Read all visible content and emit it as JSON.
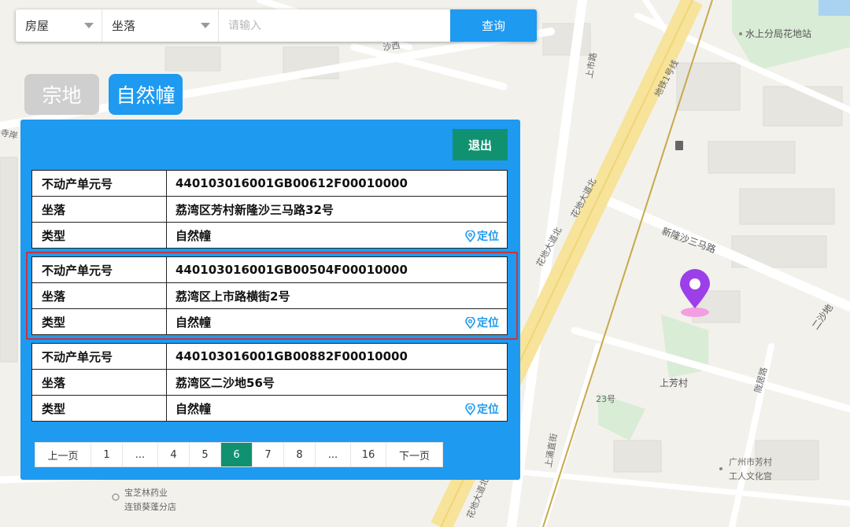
{
  "search": {
    "category_selected": "房屋",
    "field_selected": "坐落",
    "placeholder": "请输入",
    "query_label": "查询"
  },
  "modes": {
    "zongdi": "宗地",
    "ziran": "自然幢"
  },
  "panel": {
    "exit_label": "退出",
    "locate_label": "定位",
    "records": [
      {
        "label_id": "不动产单元号",
        "id": "440103016001GB00612F00010000",
        "label_loc": "坐落",
        "location": "荔湾区芳村新隆沙三马路32号",
        "label_type": "类型",
        "type": "自然幢"
      },
      {
        "label_id": "不动产单元号",
        "id": "440103016001GB00504F00010000",
        "label_loc": "坐落",
        "location": "荔湾区上市路横街2号",
        "label_type": "类型",
        "type": "自然幢"
      },
      {
        "label_id": "不动产单元号",
        "id": "440103016001GB00882F00010000",
        "label_loc": "坐落",
        "location": "荔湾区二沙地56号",
        "label_type": "类型",
        "type": "自然幢"
      }
    ],
    "pagination": {
      "prev": "上一页",
      "pages": [
        "1",
        "...",
        "4",
        "5",
        "6",
        "7",
        "8",
        "...",
        "16"
      ],
      "current": "6",
      "next": "下一页"
    }
  },
  "map": {
    "labels": {
      "water_station": "水上分局花地站",
      "metro": "地铁1号线",
      "shangshi_road": "上市路",
      "huadi_a": "花地大道北",
      "huadi_b": "花地大道北",
      "huadi_c": "花地大道北",
      "xinlongsha": "新隆沙三马路",
      "ershadi": "二沙地",
      "shangfangcun": "上芳村",
      "no23": "23号",
      "longju": "陇居路",
      "shangyong": "上涌直街",
      "fangcun_1": "广州市芳村",
      "fangcun_2": "工人文化宫",
      "pharmacy_1": "宝芝林药业",
      "pharmacy_2": "连锁葵蓬分店",
      "sha_xi": "沙西",
      "si_an": "寺岸"
    }
  }
}
